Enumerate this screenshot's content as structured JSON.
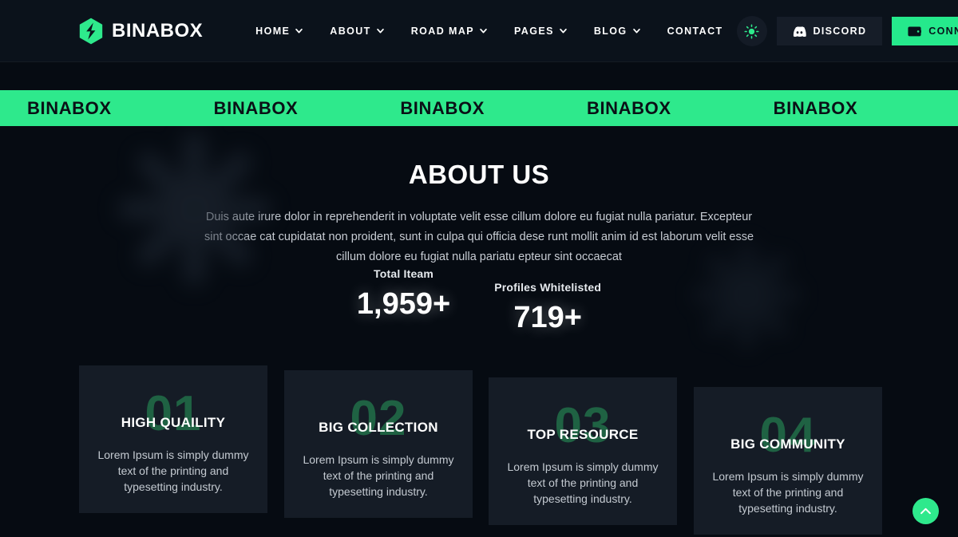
{
  "header": {
    "brand": {
      "name": "BINABOX",
      "logo_icon": "binabox-hex-logo-icon"
    },
    "nav": [
      {
        "label": "HOME",
        "has_caret": true
      },
      {
        "label": "ABOUT",
        "has_caret": true
      },
      {
        "label": "ROAD MAP",
        "has_caret": true
      },
      {
        "label": "PAGES",
        "has_caret": true
      },
      {
        "label": "BLOG",
        "has_caret": true
      },
      {
        "label": "CONTACT",
        "has_caret": false
      }
    ],
    "theme_toggle_icon": "sun-icon",
    "discord_button": {
      "label": "DISCORD",
      "icon": "discord-icon"
    },
    "connect_button": {
      "label": "CONNECT",
      "icon": "wallet-icon"
    }
  },
  "marquee": {
    "word": "BINABOX",
    "repeats": 8
  },
  "about": {
    "title": "ABOUT US",
    "description": "Duis aute irure dolor in reprehenderit in voluptate velit esse cillum dolore eu fugiat nulla pariatur. Excepteur sint occae cat cupidatat non proident, sunt in culpa qui officia dese runt mollit anim id est laborum velit esse cillum dolore eu fugiat nulla pariatu epteur sint occaecat"
  },
  "stats": [
    {
      "label": "Total Iteam",
      "value": "1,959+"
    },
    {
      "label": "Profiles Whitelisted",
      "value": "719+"
    }
  ],
  "cards": [
    {
      "number": "01",
      "title": "HIGH QUAILITY",
      "text": "Lorem Ipsum is simply dummy text of the printing and typesetting industry."
    },
    {
      "number": "02",
      "title": "BIG COLLECTION",
      "text": "Lorem Ipsum is simply dummy text of the printing and typesetting industry."
    },
    {
      "number": "03",
      "title": "TOP RESOURCE",
      "text": "Lorem Ipsum is simply dummy text of the printing and typesetting industry."
    },
    {
      "number": "04",
      "title": "BIG COMMUNITY",
      "text": "Lorem Ipsum is simply dummy text of the printing and typesetting industry."
    }
  ],
  "scroll_top": {
    "icon": "chevron-up-icon"
  },
  "colors": {
    "accent_green": "#2ee98c",
    "page_background": "#060b12",
    "header_background": "#0b121b",
    "card_background": "#151c26",
    "card_number_green": "#1f6243"
  }
}
